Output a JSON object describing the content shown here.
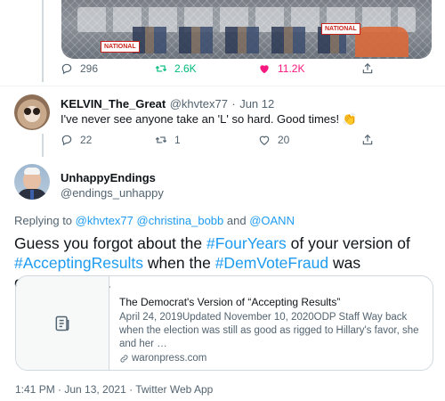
{
  "top_tweet": {
    "media_signs": [
      "NATIONAL",
      "NATIONAL"
    ],
    "actions": {
      "replies": "296",
      "retweets": "2.6K",
      "likes": "11.2K"
    }
  },
  "reply_tweet": {
    "display_name": "KELVIN_The_Great",
    "handle": "@khvtex77",
    "date": "Jun 12",
    "text": "I've never see anyone take an 'L' so hard. Good times! 👏",
    "actions": {
      "replies": "22",
      "retweets": "1",
      "likes": "20"
    }
  },
  "main_tweet": {
    "display_name": "UnhappyEndings",
    "handle": "@endings_unhappy",
    "replying_to_prefix": "Replying to ",
    "replying_to": [
      "@khvtex77",
      "@christina_bobb",
      "@OANN"
    ],
    "replying_to_joiners": [
      " ",
      " and "
    ],
    "text_parts": [
      {
        "text": "Guess you forgot about the ",
        "link": false
      },
      {
        "text": "#FourYears",
        "link": true
      },
      {
        "text": " of your version of ",
        "link": false
      },
      {
        "text": "#AcceptingResults",
        "link": true
      },
      {
        "text": " when the ",
        "link": false
      },
      {
        "text": "#DemVoteFraud",
        "link": true
      },
      {
        "text": " was overwhelmed.",
        "link": false
      }
    ],
    "card": {
      "title": "The Democrat's Version of “Accepting Results”",
      "description": "April 24, 2019Updated November 10, 2020ODP Staff Way back when the election was still as good as rigged to Hillary's favor, she and her …",
      "domain": "waronpress.com"
    },
    "timestamp": "1:41 PM · Jun 13, 2021 · Twitter Web App"
  },
  "icons": {
    "reply": "reply-icon",
    "retweet": "retweet-icon",
    "like": "heart-icon",
    "share": "share-icon",
    "card_thumb": "document-icon",
    "domain": "link-icon"
  },
  "colors": {
    "accent": "#1d9bf0",
    "like": "#f91880",
    "retweet": "#00ba7c",
    "secondary_text": "#536471"
  }
}
